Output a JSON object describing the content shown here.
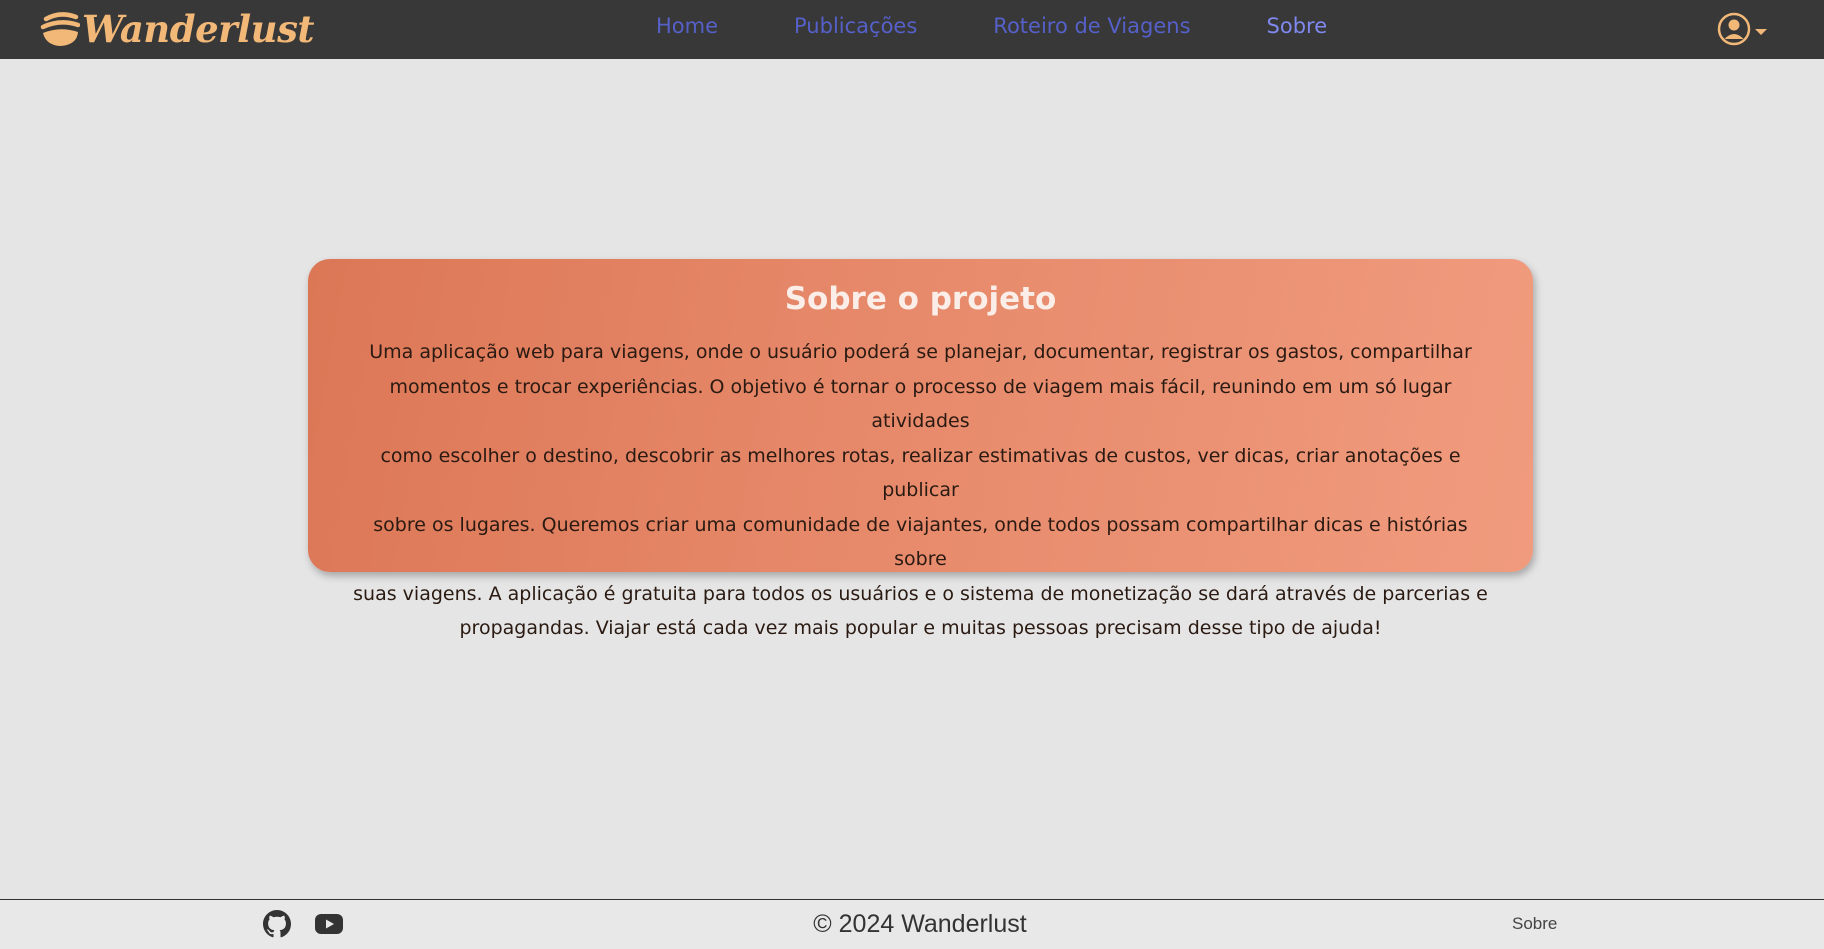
{
  "header": {
    "brand": "Wanderlust",
    "nav": [
      {
        "label": "Home"
      },
      {
        "label": "Publicações"
      },
      {
        "label": "Roteiro de Viagens"
      },
      {
        "label": "Sobre",
        "active": true
      }
    ],
    "user_icon": "user-circle-icon",
    "colors": {
      "bar": "#383838",
      "brand": "#f2b878",
      "link": "#5560c8",
      "link_active": "#7f88ee"
    }
  },
  "card": {
    "title": "Sobre o projeto",
    "lines": [
      "Uma aplicação web para viagens, onde o usuário poderá se planejar, documentar, registrar os gastos, compartilhar",
      "momentos e trocar experiências. O objetivo é tornar o processo de viagem mais fácil, reunindo em um só lugar atividades",
      "como escolher o destino, descobrir as melhores rotas, realizar estimativas de custos, ver dicas, criar anotações e publicar",
      "sobre os lugares. Queremos criar uma comunidade de viajantes, onde todos possam compartilhar dicas e histórias sobre",
      "suas viagens. A aplicação é gratuita para todos os usuários e o sistema de monetização se dará através de parcerias e",
      "propagandas. Viajar está cada vez mais popular e muitas pessoas precisam desse tipo de ajuda!"
    ],
    "colors": {
      "from": "#dc7756",
      "to": "#f19b7e"
    }
  },
  "footer": {
    "social_icons": [
      "github-icon",
      "youtube-icon"
    ],
    "copyright": "© 2024 Wanderlust",
    "link": "Sobre"
  }
}
